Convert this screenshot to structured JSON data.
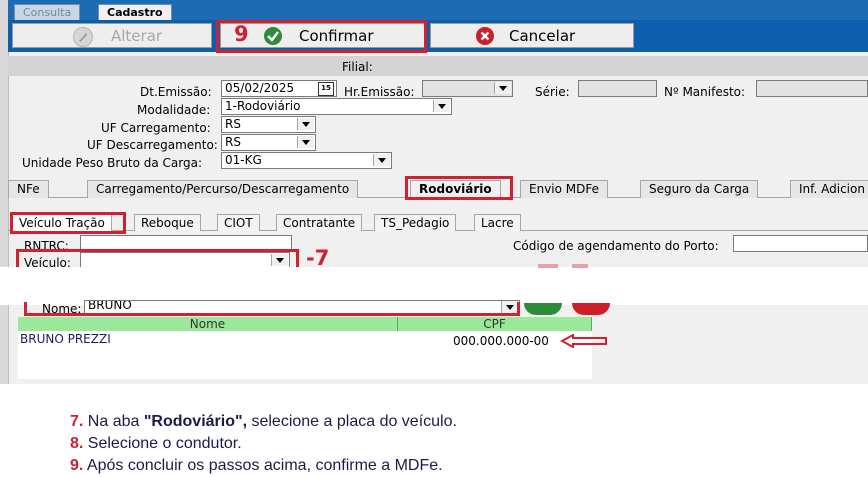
{
  "top_tabs": [
    {
      "label": "Consulta",
      "active": false
    },
    {
      "label": "Cadastro",
      "active": true
    }
  ],
  "toolbar": {
    "alterar": "Alterar",
    "confirmar": "Confirmar",
    "cancelar": "Cancelar",
    "step9": "9"
  },
  "filial_label": "Filial:",
  "form": {
    "dt_emissao_label": "Dt.Emissão:",
    "dt_emissao_value": "05/02/2025",
    "calendar_badge": "15",
    "hr_emissao_label": "Hr.Emissão:",
    "serie_label": "Série:",
    "manifesto_label": "Nº Manifesto:",
    "modalidade_label": "Modalidade:",
    "modalidade_value": "1-Rodoviário",
    "uf_carregamento_label": "UF Carregamento:",
    "uf_carregamento_value": "RS",
    "uf_descarregamento_label": "UF Descarregamento:",
    "uf_descarregamento_value": "RS",
    "unidade_peso_label": "Unidade Peso Bruto da Carga:",
    "unidade_peso_value": "01-KG"
  },
  "main_tabs": [
    "NFe",
    "Carregamento/Percurso/Descarregamento",
    "Rodoviário",
    "Envio MDFe",
    "Seguro da Carga",
    "Inf. Adicion"
  ],
  "sub_tabs": [
    "Veículo Tração",
    "Reboque",
    "CIOT",
    "Contratante",
    "TS_Pedagio",
    "Lacre"
  ],
  "rodoviario": {
    "rntrc_label": "RNTRC:",
    "codigo_agendamento_label": "Código de agendamento do Porto:",
    "veiculo_label": "Veículo:",
    "step7": "-7",
    "nome_label": "Nome:",
    "nome_value": "BRUNO"
  },
  "grid": {
    "headers": [
      "Nome",
      "CPF"
    ],
    "rows": [
      {
        "nome": "BRUNO PREZZI",
        "cpf": "000.000.000-00"
      }
    ]
  },
  "instructions": [
    {
      "num": "7.",
      "pre": "Na aba ",
      "bold": "\"Rodoviário\",",
      "post": " selecione a placa do veículo."
    },
    {
      "num": "8.",
      "pre": "Selecione o condutor.",
      "bold": "",
      "post": ""
    },
    {
      "num": "9.",
      "pre": "Após concluir os passos acima, confirme a MDFe.",
      "bold": "",
      "post": ""
    }
  ],
  "colors": {
    "toolbar_bg": "#0d5fae",
    "highlight_red": "#d1202f",
    "grid_header": "#9be89b",
    "confirm_green": "#2e8b3a",
    "cancel_red": "#cc1f2a"
  }
}
